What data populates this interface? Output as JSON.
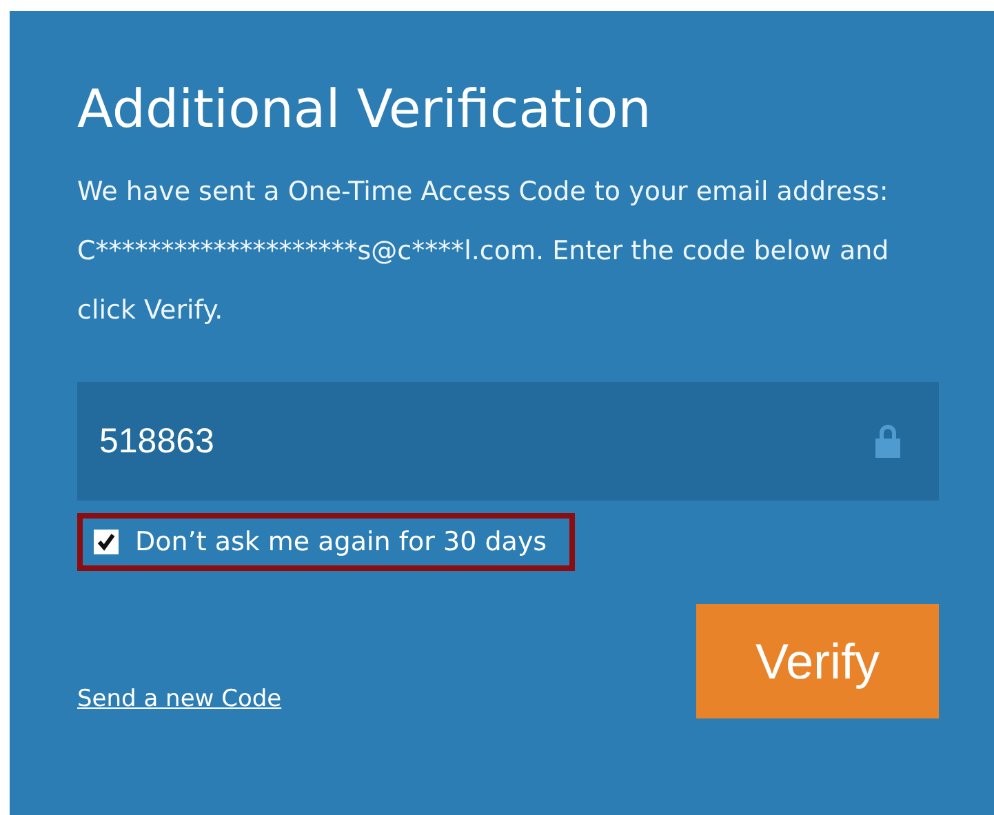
{
  "title": "Additional Verification",
  "message": "We have sent a One-Time Access Code to your email address: C********************s@c****l.com. Enter the code below and click Verify.",
  "code_field": {
    "value": "518863"
  },
  "remember": {
    "label": "Don’t ask me again for 30 days",
    "checked": true,
    "highlighted": true
  },
  "link": "Send a new Code",
  "button": "Verify"
}
